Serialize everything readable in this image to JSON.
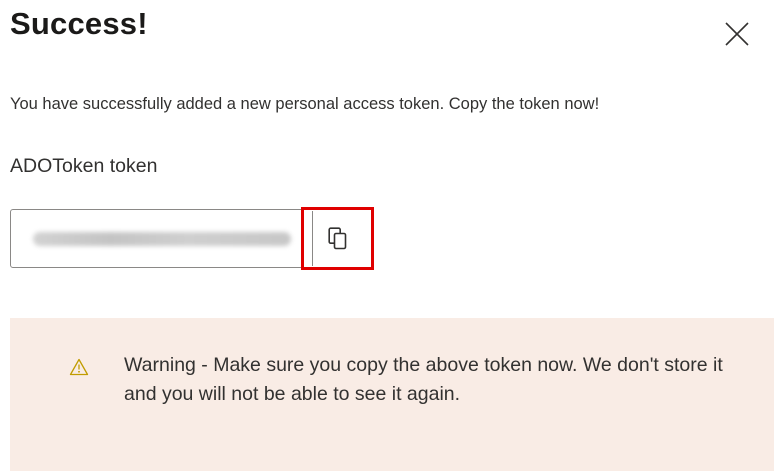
{
  "dialog": {
    "title": "Success!",
    "close_icon": "close-icon",
    "message": "You have successfully added a new personal access token. Copy the token now!",
    "token_name": "ADOToken token",
    "copy_icon": "copy-icon",
    "warning_icon": "warning-icon",
    "warning_text": "Warning - Make sure you copy the above token now. We don't store it and you will not be able to see it again."
  },
  "colors": {
    "highlight": "#e00000",
    "warning_background": "#f9ece5",
    "warning_icon": "#c19c00"
  }
}
